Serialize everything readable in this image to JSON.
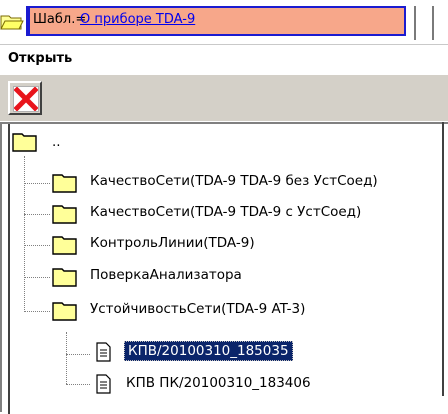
{
  "header": {
    "top_fragment": "▪ ▪ ▪",
    "template_label": "Шабл.=",
    "template_link": "О приборе TDA-9"
  },
  "toolbar": {
    "open_label": "Открыть",
    "close_icon": "close-icon",
    "close_color": "#e8141b"
  },
  "tree": {
    "root_label": "..",
    "folders": [
      "КачествоСети(TDA-9 TDA-9 без УстСоед)",
      "КачествоСети(TDA-9 TDA-9 с УстСоед)",
      "КонтрольЛинии(TDA-9)",
      "ПоверкаАнализатора",
      "УстойчивостьСети(TDA-9 AT-3)"
    ],
    "files": [
      {
        "label": "КПВ/20100310_185035",
        "selected": true
      },
      {
        "label": "КПВ ПК/20100310_183406",
        "selected": false
      }
    ]
  },
  "colors": {
    "selection": "#0a246a",
    "folder_fill": "#ffff99",
    "template_fill": "#f7a78a",
    "template_border": "#1b1bd0"
  }
}
